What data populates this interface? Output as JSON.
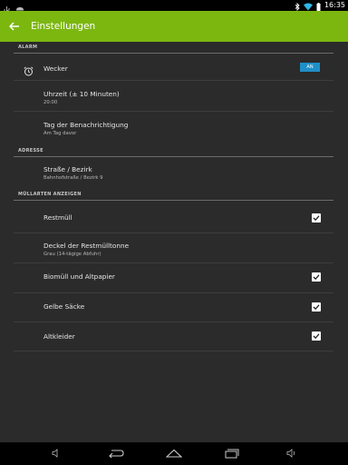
{
  "status_bar": {
    "time": "16:35",
    "left_icons": [
      "usb-icon",
      "android-icon"
    ],
    "right_icons": [
      "bluetooth-icon",
      "wifi-icon",
      "battery-icon"
    ]
  },
  "action_bar": {
    "title": "Einstellungen",
    "color": "#7cb70f",
    "back_icon": "arrow-back-icon"
  },
  "sections": {
    "alarm": {
      "header": "ALARM",
      "wecker": {
        "title": "Wecker",
        "toggle_label": "AN",
        "icon": "alarm-clock-icon"
      },
      "uhrzeit": {
        "title": "Uhrzeit (± 10 Minuten)",
        "summary": "20:00"
      },
      "tag": {
        "title": "Tag der Benachrichtigung",
        "summary": "Am Tag davor"
      }
    },
    "adresse": {
      "header": "ADRESSE",
      "strasse": {
        "title": "Straße / Bezirk",
        "summary": "Bahnhofstraße / Bezirk 9"
      }
    },
    "muellarten": {
      "header": "MÜLLARTEN ANZEIGEN",
      "restmuell": {
        "title": "Restmüll",
        "checked": true
      },
      "deckel": {
        "title": "Deckel der Restmülltonne",
        "summary": "Grau (14-tägige Abfuhr)"
      },
      "biomuell": {
        "title": "Biomüll und Altpapier",
        "checked": true
      },
      "gelbe": {
        "title": "Gelbe Säcke",
        "checked": true
      },
      "altkleider": {
        "title": "Altkleider",
        "checked": true
      }
    }
  },
  "nav_bar": {
    "icons": [
      "volume-down-icon",
      "back-icon",
      "home-icon",
      "recents-icon",
      "volume-up-icon"
    ]
  },
  "colors": {
    "accent": "#7cb70f",
    "toggle": "#1f8fc7",
    "background": "#2b2b2b"
  }
}
